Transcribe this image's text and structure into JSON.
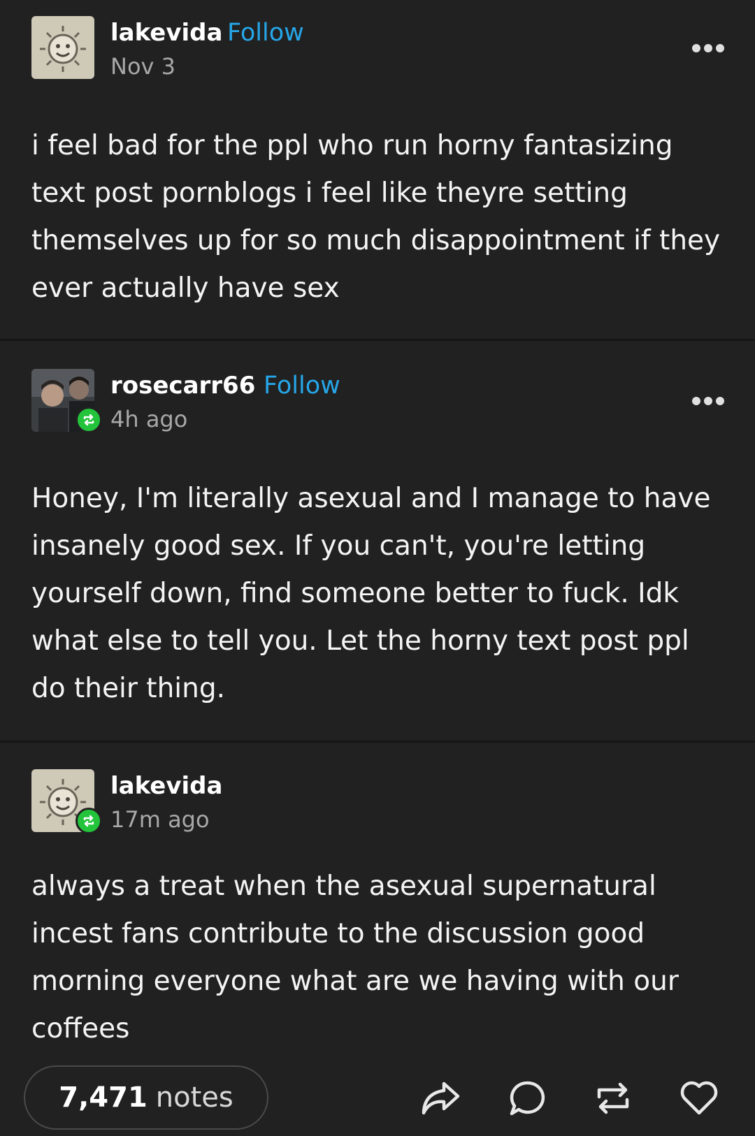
{
  "posts": [
    {
      "username": "lakevida",
      "follow_label": "Follow",
      "timestamp": "Nov 3",
      "avatar": "sun-face-avatar",
      "text": "i feel bad for the ppl who run horny fantasizing text post pornblogs i feel like theyre setting themselves up for so much disappointment if they ever actually have sex"
    },
    {
      "username": "rosecarr66",
      "follow_label": "Follow",
      "timestamp": "4h ago",
      "avatar": "photo-avatar",
      "reblog_badge": "reblog-icon",
      "text": "Honey, I'm literally asexual and I manage to have insanely good sex. If you can't, you're letting yourself down, find someone better to fuck. Idk what else to tell you. Let the horny text post ppl do their thing."
    },
    {
      "username": "lakevida",
      "timestamp": "17m ago",
      "avatar": "sun-face-avatar",
      "reblog_badge": "reblog-icon",
      "text": "always a treat when the asexual supernatural incest fans contribute to the discussion good morning everyone what are we having with our coffees"
    }
  ],
  "footer": {
    "notes_count": "7,471",
    "notes_label": "notes",
    "actions": [
      "share-icon",
      "comment-icon",
      "reblog-icon",
      "heart-icon"
    ]
  },
  "colors": {
    "background": "#212121",
    "follow": "#26a6e8",
    "reblog_badge": "#23c43b",
    "muted": "#a8a8a8"
  }
}
